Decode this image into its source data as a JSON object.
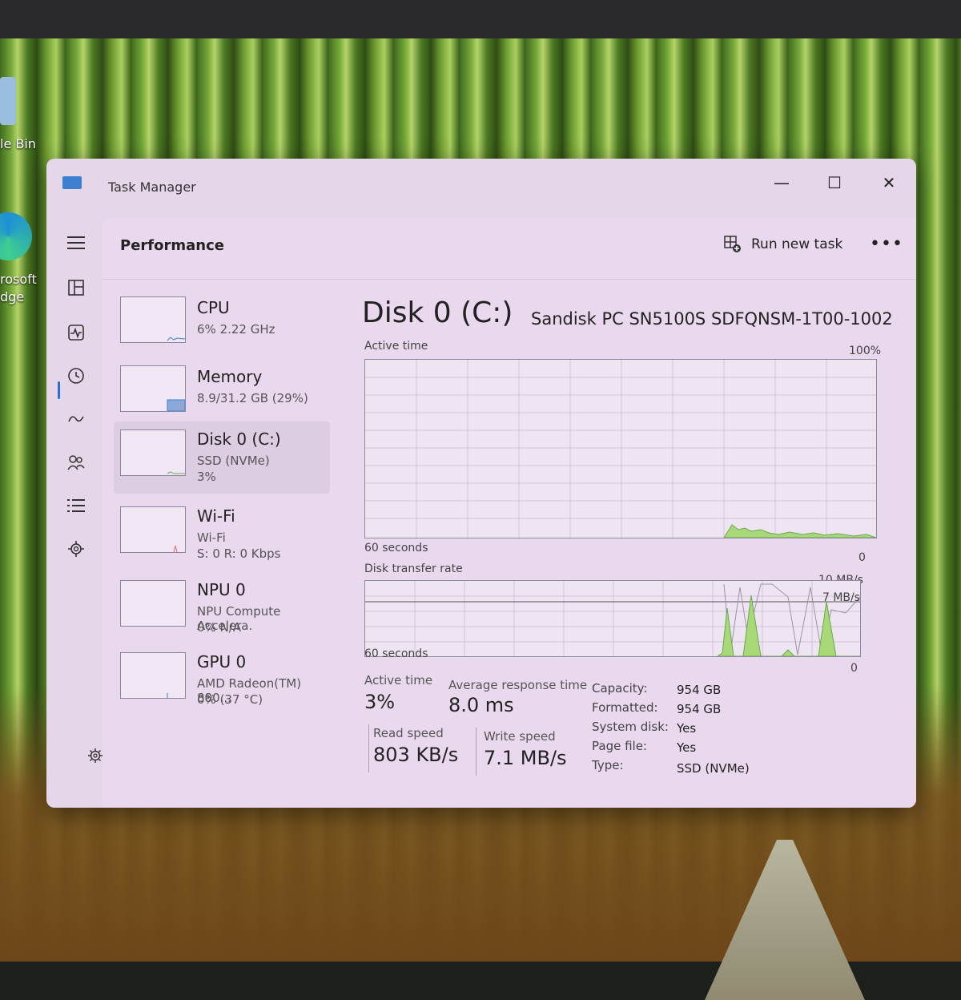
{
  "desktop": {
    "icons": [
      {
        "label": "le Bin"
      },
      {
        "label": "rosoft\ndge"
      }
    ]
  },
  "window": {
    "title": "Task Manager",
    "controls": {
      "minimize": "—",
      "maximize": "☐",
      "close": "✕"
    }
  },
  "header": {
    "title": "Performance",
    "run_new_task": "Run new task",
    "more": "•••"
  },
  "devices": [
    {
      "name": "CPU",
      "sub": "6% 2.22 GHz",
      "sub2": ""
    },
    {
      "name": "Memory",
      "sub": "8.9/31.2 GB (29%)",
      "sub2": ""
    },
    {
      "name": "Disk 0 (C:)",
      "sub": "SSD (NVMe)",
      "sub2": "3%"
    },
    {
      "name": "Wi-Fi",
      "sub": "Wi-Fi",
      "sub2": "S: 0 R: 0 Kbps"
    },
    {
      "name": "NPU 0",
      "sub": "NPU Compute Accelera.",
      "sub2": "0% N/A"
    },
    {
      "name": "GPU 0",
      "sub": "AMD Radeon(TM) 880...",
      "sub2": "0% (37 °C)"
    }
  ],
  "detail": {
    "title": "Disk 0 (C:)",
    "model": "Sandisk PC SN5100S SDFQNSM-1T00-1002",
    "active_chart": {
      "label": "Active time",
      "max": "100%",
      "span": "60 seconds",
      "min": "0"
    },
    "transfer_chart": {
      "label": "Disk transfer rate",
      "max": "10 MB/s",
      "mid": "7 MB/s",
      "span": "60 seconds",
      "min": "0"
    },
    "stats": {
      "active_time_label": "Active time",
      "active_time": "3%",
      "avg_resp_label": "Average response time",
      "avg_resp": "8.0 ms",
      "read_label": "Read speed",
      "read": "803 KB/s",
      "write_label": "Write speed",
      "write": "7.1 MB/s"
    },
    "props": [
      {
        "k": "Capacity:",
        "v": "954 GB"
      },
      {
        "k": "Formatted:",
        "v": "954 GB"
      },
      {
        "k": "System disk:",
        "v": "Yes"
      },
      {
        "k": "Page file:",
        "v": "Yes"
      },
      {
        "k": "Type:",
        "v": "SSD (NVMe)"
      }
    ]
  },
  "colors": {
    "accent": "#2a6fc9",
    "disk_fill": "#a8d878",
    "disk_line": "#6aa84f"
  }
}
